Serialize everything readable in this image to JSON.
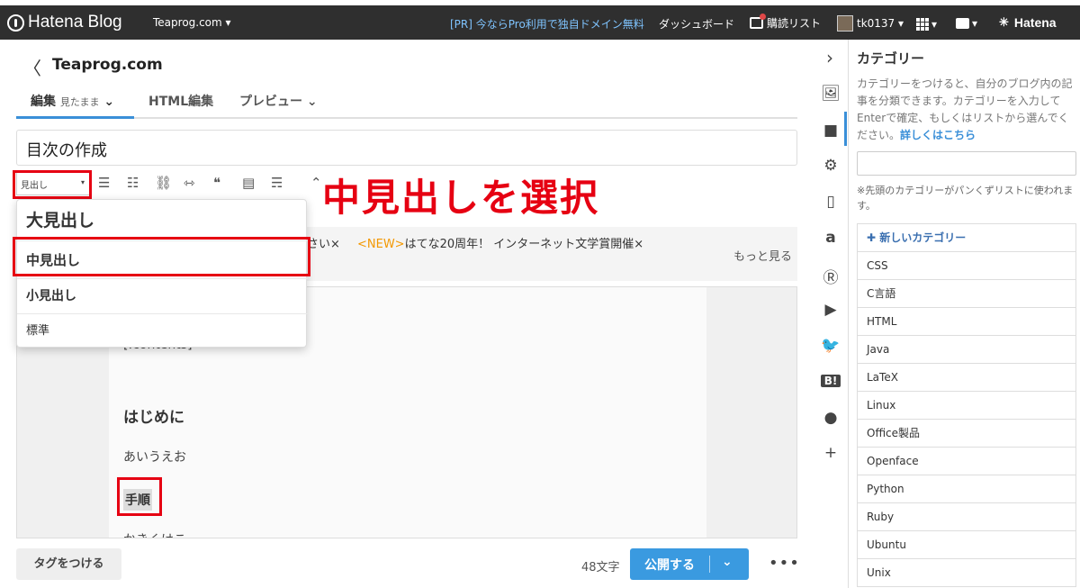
{
  "topbar": {
    "logo": "Hatena Blog",
    "blog_selector": "Teaprog.com ▾",
    "promo": "[PR] 今ならPro利用で独自ドメイン無料",
    "dashboard": "ダッシュボード",
    "reader": "購読リスト",
    "user": "tk0137 ▾",
    "apps_caret": "▾",
    "notif_caret": "▾",
    "hatena": "Hatena"
  },
  "editor": {
    "back": "〈",
    "blog_name": "Teaprog.com",
    "tabs": {
      "edit": "編集",
      "edit_mode": "見たまま",
      "html": "HTML編集",
      "preview": "プレビュー"
    },
    "title": "目次の作成",
    "heading_select": "見出し",
    "annotation": "中見出しを選択",
    "notice_partial": "さい×",
    "notice_new_tag": "<NEW>",
    "notice_text": "はてな20周年！ インターネット文学賞開催×",
    "notice_more": "もっと見る",
    "dropdown": [
      "大見出し",
      "中見出し",
      "小見出し",
      "標準"
    ],
    "body": {
      "contents": "[:contents]",
      "h3": "はじめに",
      "p1": "あいうえお",
      "h4": "手順",
      "p2": "かきくけこ"
    }
  },
  "footer": {
    "tag_button": "タグをつける",
    "char_count": "48文字",
    "publish": "公開する",
    "publish_caret": "⌄",
    "more": "•••"
  },
  "panel": {
    "title": "カテゴリー",
    "description": "カテゴリーをつけると、自分のブログ内の記事を分類できます。カテゴリーを入力してEnterで確定、もしくはリストから選んでください。",
    "link": "詳しくはこちら",
    "note": "※先頭のカテゴリーがパンくずリストに使われます。",
    "add_category": "✚ 新しいカテゴリー",
    "categories": [
      "CSS",
      "C言語",
      "HTML",
      "Java",
      "LaTeX",
      "Linux",
      "Office製品",
      "Openface",
      "Python",
      "Ruby",
      "Ubuntu",
      "Unix"
    ]
  }
}
